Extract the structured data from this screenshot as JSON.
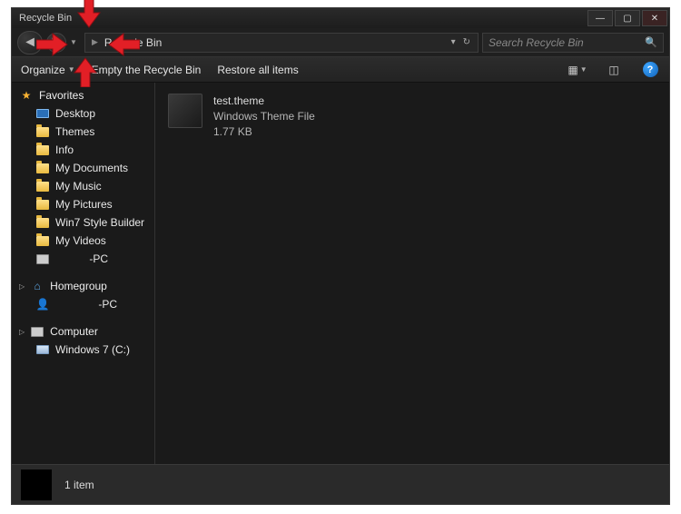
{
  "window": {
    "title": "Recycle Bin",
    "min_tip": "Minimize",
    "max_tip": "Maximize",
    "close_tip": "Close"
  },
  "address": {
    "segment1": "Recycle Bin",
    "dropdown_glyph": "▾",
    "refresh_glyph": "↻"
  },
  "search": {
    "placeholder": "Search Recycle Bin"
  },
  "toolbar": {
    "organize": "Organize",
    "empty": "Empty the Recycle Bin",
    "restore": "Restore all items",
    "view_glyph": "▦",
    "preview_glyph": "◫",
    "help_glyph": "?"
  },
  "sidebar": {
    "favorites": {
      "label": "Favorites",
      "items": [
        {
          "label": "Desktop",
          "icon": "desktop"
        },
        {
          "label": "Themes",
          "icon": "folder"
        },
        {
          "label": "Info",
          "icon": "folder"
        },
        {
          "label": "My Documents",
          "icon": "folder"
        },
        {
          "label": "My Music",
          "icon": "folder"
        },
        {
          "label": "My Pictures",
          "icon": "folder"
        },
        {
          "label": "Win7 Style Builder",
          "icon": "folder"
        },
        {
          "label": "My Videos",
          "icon": "folder"
        },
        {
          "label": "-PC",
          "icon": "pc",
          "redacted_prefix": true
        }
      ]
    },
    "homegroup": {
      "label": "Homegroup",
      "items": [
        {
          "label": "-PC",
          "icon": "user",
          "redacted_prefix": true
        }
      ]
    },
    "computer": {
      "label": "Computer",
      "items": [
        {
          "label": "Windows 7 (C:)",
          "icon": "drive"
        }
      ]
    }
  },
  "content": {
    "file": {
      "name": "test.theme",
      "type": "Windows Theme File",
      "size": "1.77 KB"
    }
  },
  "statusbar": {
    "count": "1 item"
  },
  "annotations": {
    "arrow_top": "down",
    "arrow_left": "right",
    "arrow_bl": "left",
    "arrow_bottom": "up"
  }
}
